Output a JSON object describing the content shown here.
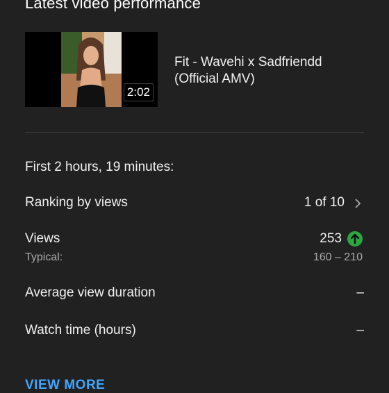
{
  "card": {
    "title": "Latest video performance",
    "video": {
      "title": "Fit - Wavehi x Sadfriendd (Official AMV)",
      "duration": "2:02"
    },
    "period": "First 2 hours, 19 minutes:",
    "ranking": {
      "label": "Ranking by views",
      "value": "1 of 10"
    },
    "views": {
      "label": "Views",
      "value": "253",
      "trend_icon": "arrow-up-circle-icon",
      "typical_label": "Typical:",
      "typical_value": "160 – 210"
    },
    "avg_view_duration": {
      "label": "Average view duration",
      "value": "–"
    },
    "watch_time": {
      "label": "Watch time (hours)",
      "value": "–"
    },
    "view_more_label": "VIEW MORE"
  },
  "colors": {
    "background": "#212121",
    "accent": "#3ea6ff",
    "positive": "#2ba640",
    "secondary_text": "#aaaaaa"
  }
}
